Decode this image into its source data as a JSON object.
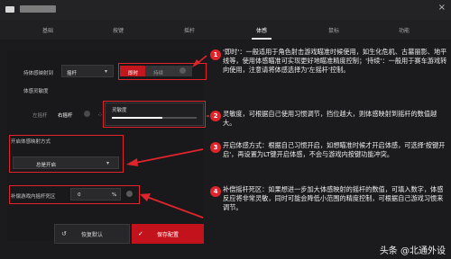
{
  "window": {
    "close_glyph": "×"
  },
  "tabs": [
    {
      "label": "基础"
    },
    {
      "label": "按键"
    },
    {
      "label": "摇杆"
    },
    {
      "label": "体感"
    },
    {
      "label": "鼠标"
    },
    {
      "label": "功能"
    }
  ],
  "active_tab": "体感",
  "settings": {
    "gyro_mapping": {
      "label": "持体感映射到",
      "value": "摇杆"
    },
    "gyro_mode": {
      "label": "",
      "options": [
        "即时",
        "持续"
      ],
      "selected": "即时"
    },
    "sensitivity": {
      "label": "体感灵敏度"
    },
    "stick_target": {
      "options": [
        "左摇杆",
        "右摇杆"
      ],
      "selected": "右摇杆"
    },
    "sensitivity_slider": {
      "label": "灵敏度",
      "level": 0.6
    },
    "activation": {
      "label": "开启体感映射方式",
      "value": "总是开启"
    },
    "compensation": {
      "label": "补偿游戏内摇杆死区",
      "value": "0",
      "unit": "%"
    },
    "reset_button": "恢复默认",
    "save_button": "保存配置"
  },
  "notes": [
    {
      "num": "1",
      "text": "'即时'：一般适用于角色射击游戏瞄准时候使用，如生化危机、古墓丽影、地平线等，使用体感瞄准可实现更好地瞄准精度控制；'持续'：一般用于赛车游戏转向使用，注意请将体感选择为'左摇杆'控制。"
    },
    {
      "num": "2",
      "text": "灵敏度，可根据自己使用习惯调节，挡位越大，则体感映射到摇杆的数值越大。"
    },
    {
      "num": "3",
      "text": "开启体感方式：根据自己习惯开启，如想瞄准时候才开启体感，可选择'按键开启'，再设置为LT键开启体感，不会与游戏内按键功能冲突。"
    },
    {
      "num": "4",
      "text": "补偿摇杆死区：如果想进一步加大体感映射的摇杆的数值，可填入数字，体感反应将非常灵敏，同时可能会降低小范围的精度控制，可根据自己游戏习惯来调节。"
    }
  ],
  "watermark": "头条 @北通外设",
  "colors": {
    "accent": "#c4121d",
    "annotation": "#e0242c",
    "background": "#1b1b1d"
  }
}
